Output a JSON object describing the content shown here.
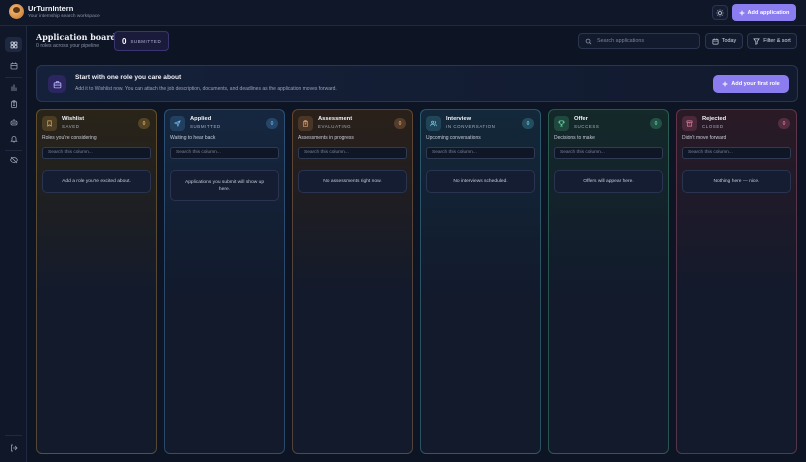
{
  "app": {
    "title": "UrTurnIntern",
    "subtitle": "Your internship search workspace",
    "add_application_label": "Add application",
    "logo_icon": "avatar-icon",
    "theme_icon": "sun-icon"
  },
  "sidebar": {
    "items": [
      {
        "name": "board",
        "icon": "grid-icon",
        "active": true
      },
      {
        "name": "calendar",
        "icon": "calendar-icon",
        "active": false
      },
      {
        "name": "analytics",
        "icon": "bar-chart-icon",
        "active": false
      },
      {
        "name": "documents",
        "icon": "clipboard-icon",
        "active": false
      },
      {
        "name": "ai",
        "icon": "bot-icon",
        "active": false
      },
      {
        "name": "notifications",
        "icon": "bell-icon",
        "active": false
      },
      {
        "name": "hide",
        "icon": "eye-off-icon",
        "active": false
      }
    ],
    "logout_icon": "logout-icon"
  },
  "header": {
    "title": "Application board",
    "subtitle": "0 roles across your pipeline",
    "submitted_count": "0",
    "submitted_label": "SUBMITTED",
    "search_placeholder": "Search applications",
    "today_label": "Today",
    "filter_label": "Filter & sort"
  },
  "banner": {
    "title": "Start with one role you care about",
    "subtitle": "Add it to Wishlist now. You can attach the job description, documents, and deadlines as the application moves forward.",
    "button_label": "Add your first role"
  },
  "columns": [
    {
      "title": "Wishlist",
      "status": "SAVED",
      "count": "0",
      "description": "Roles you're considering",
      "search_placeholder": "Search this column...",
      "empty_text": "Add a role you're excited about.",
      "accent": "#d8a64a",
      "tint": "#2a2418",
      "icon": "bookmark-icon"
    },
    {
      "title": "Applied",
      "status": "SUBMITTED",
      "count": "0",
      "description": "Waiting to hear back",
      "search_placeholder": "Search this column...",
      "empty_text": "Applications you submit will show up here.",
      "accent": "#5aa6e8",
      "tint": "#15273f",
      "icon": "send-icon"
    },
    {
      "title": "Assessment",
      "status": "EVALUATING",
      "count": "0",
      "description": "Assessments in progress",
      "search_placeholder": "Search this column...",
      "empty_text": "No assessments right now.",
      "accent": "#d2935a",
      "tint": "#2a2019",
      "icon": "clipboard-icon"
    },
    {
      "title": "Interview",
      "status": "IN CONVERSATION",
      "count": "0",
      "description": "Upcoming conversations",
      "search_placeholder": "Search this column...",
      "empty_text": "No interviews scheduled.",
      "accent": "#5cc0d6",
      "tint": "#13283a",
      "icon": "users-icon"
    },
    {
      "title": "Offer",
      "status": "SUCCESS",
      "count": "0",
      "description": "Decisions to make",
      "search_placeholder": "Search this column...",
      "empty_text": "Offers will appear here.",
      "accent": "#55c996",
      "tint": "#14292a",
      "icon": "trophy-icon"
    },
    {
      "title": "Rejected",
      "status": "CLOSED",
      "count": "0",
      "description": "Didn't move forward",
      "search_placeholder": "Search this column...",
      "empty_text": "Nothing here — nice.",
      "accent": "#d46a8a",
      "tint": "#2a1a26",
      "icon": "archive-icon"
    }
  ]
}
